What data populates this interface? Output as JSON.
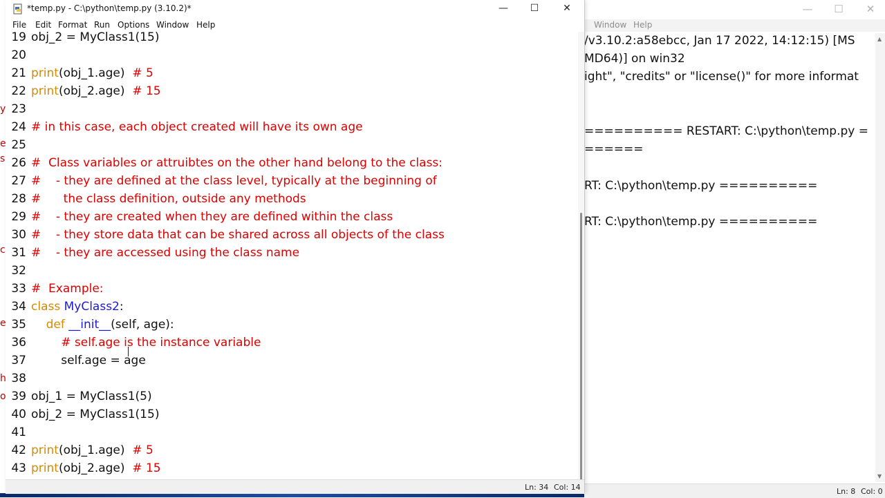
{
  "editor": {
    "title": "*temp.py - C:\\python\\temp.py (3.10.2)*",
    "menu": [
      "File",
      "Edit",
      "Format",
      "Run",
      "Options",
      "Window",
      "Help"
    ],
    "controls": {
      "minimize": "—",
      "maximize": "☐",
      "close": "✕"
    },
    "lines": [
      {
        "n": "19",
        "segs": [
          {
            "t": "obj_2 = MyClass1(15)",
            "c": "plain"
          }
        ]
      },
      {
        "n": "20",
        "segs": []
      },
      {
        "n": "21",
        "segs": [
          {
            "t": "print",
            "c": "kw"
          },
          {
            "t": "(obj_1.age)  ",
            "c": "plain"
          },
          {
            "t": "# 5",
            "c": "cm"
          }
        ]
      },
      {
        "n": "22",
        "segs": [
          {
            "t": "print",
            "c": "kw"
          },
          {
            "t": "(obj_2.age)  ",
            "c": "plain"
          },
          {
            "t": "# 15",
            "c": "cm"
          }
        ]
      },
      {
        "n": "23",
        "segs": []
      },
      {
        "n": "24",
        "segs": [
          {
            "t": "# in this case, each object created will have its own age",
            "c": "cm"
          }
        ]
      },
      {
        "n": "25",
        "segs": []
      },
      {
        "n": "26",
        "segs": [
          {
            "t": "#  Class variables or attruibtes on the other hand belong to the class:",
            "c": "cm"
          }
        ]
      },
      {
        "n": "27",
        "segs": [
          {
            "t": "#    - they are defined at the class level, typically at the beginning of",
            "c": "cm"
          }
        ]
      },
      {
        "n": "28",
        "segs": [
          {
            "t": "#      the class definition, outside any methods",
            "c": "cm"
          }
        ]
      },
      {
        "n": "29",
        "segs": [
          {
            "t": "#    - they are created when they are defined within the class",
            "c": "cm"
          }
        ]
      },
      {
        "n": "30",
        "segs": [
          {
            "t": "#    - they store data that can be shared across all objects of the class",
            "c": "cm"
          }
        ]
      },
      {
        "n": "31",
        "segs": [
          {
            "t": "#    - they are accessed using the class name",
            "c": "cm"
          }
        ]
      },
      {
        "n": "32",
        "segs": []
      },
      {
        "n": "33",
        "segs": [
          {
            "t": "#  Example:",
            "c": "cm"
          }
        ]
      },
      {
        "n": "34",
        "segs": [
          {
            "t": "class ",
            "c": "kw"
          },
          {
            "t": "MyClass2",
            "c": "cls"
          },
          {
            "t": ":",
            "c": "plain"
          }
        ]
      },
      {
        "n": "35",
        "segs": [
          {
            "t": "    ",
            "c": "plain"
          },
          {
            "t": "def ",
            "c": "kw"
          },
          {
            "t": "__init__",
            "c": "cls"
          },
          {
            "t": "(self, age):",
            "c": "plain"
          }
        ]
      },
      {
        "n": "36",
        "segs": [
          {
            "t": "        ",
            "c": "plain"
          },
          {
            "t": "# self.age is the instance variable",
            "c": "cm"
          }
        ]
      },
      {
        "n": "37",
        "segs": [
          {
            "t": "        self.age = age",
            "c": "plain"
          }
        ]
      },
      {
        "n": "38",
        "segs": []
      },
      {
        "n": "39",
        "segs": [
          {
            "t": "obj_1 = MyClass1(5)",
            "c": "plain"
          }
        ]
      },
      {
        "n": "40",
        "segs": [
          {
            "t": "obj_2 = MyClass1(15)",
            "c": "plain"
          }
        ]
      },
      {
        "n": "41",
        "segs": []
      },
      {
        "n": "42",
        "segs": [
          {
            "t": "print",
            "c": "kw"
          },
          {
            "t": "(obj_1.age)  ",
            "c": "plain"
          },
          {
            "t": "# 5",
            "c": "cm"
          }
        ]
      },
      {
        "n": "43",
        "segs": [
          {
            "t": "print",
            "c": "kw"
          },
          {
            "t": "(obj_2.age)  ",
            "c": "plain"
          },
          {
            "t": "# 15",
            "c": "cm"
          }
        ]
      }
    ],
    "status": {
      "ln": "Ln: 34",
      "col": "Col: 14"
    }
  },
  "shell": {
    "menu": [
      "Window",
      "Help"
    ],
    "output": [
      "/v3.10.2:a58ebcc, Jan 17 2022, 14:12:15) [MS",
      "MD64)] on win32",
      "ight\", \"credits\" or \"license()\" for more informat",
      "",
      "",
      "========== RESTART: C:\\python\\temp.py ====",
      "======",
      "",
      "RT: C:\\python\\temp.py ==========",
      "",
      "RT: C:\\python\\temp.py =========="
    ],
    "status": {
      "ln": "Ln: 8",
      "col": "Col: 0"
    }
  },
  "colors": {
    "keyword": "#d78a00",
    "builtin_def": "#1a1ad8",
    "comment": "#dd0000",
    "text": "#111111"
  }
}
